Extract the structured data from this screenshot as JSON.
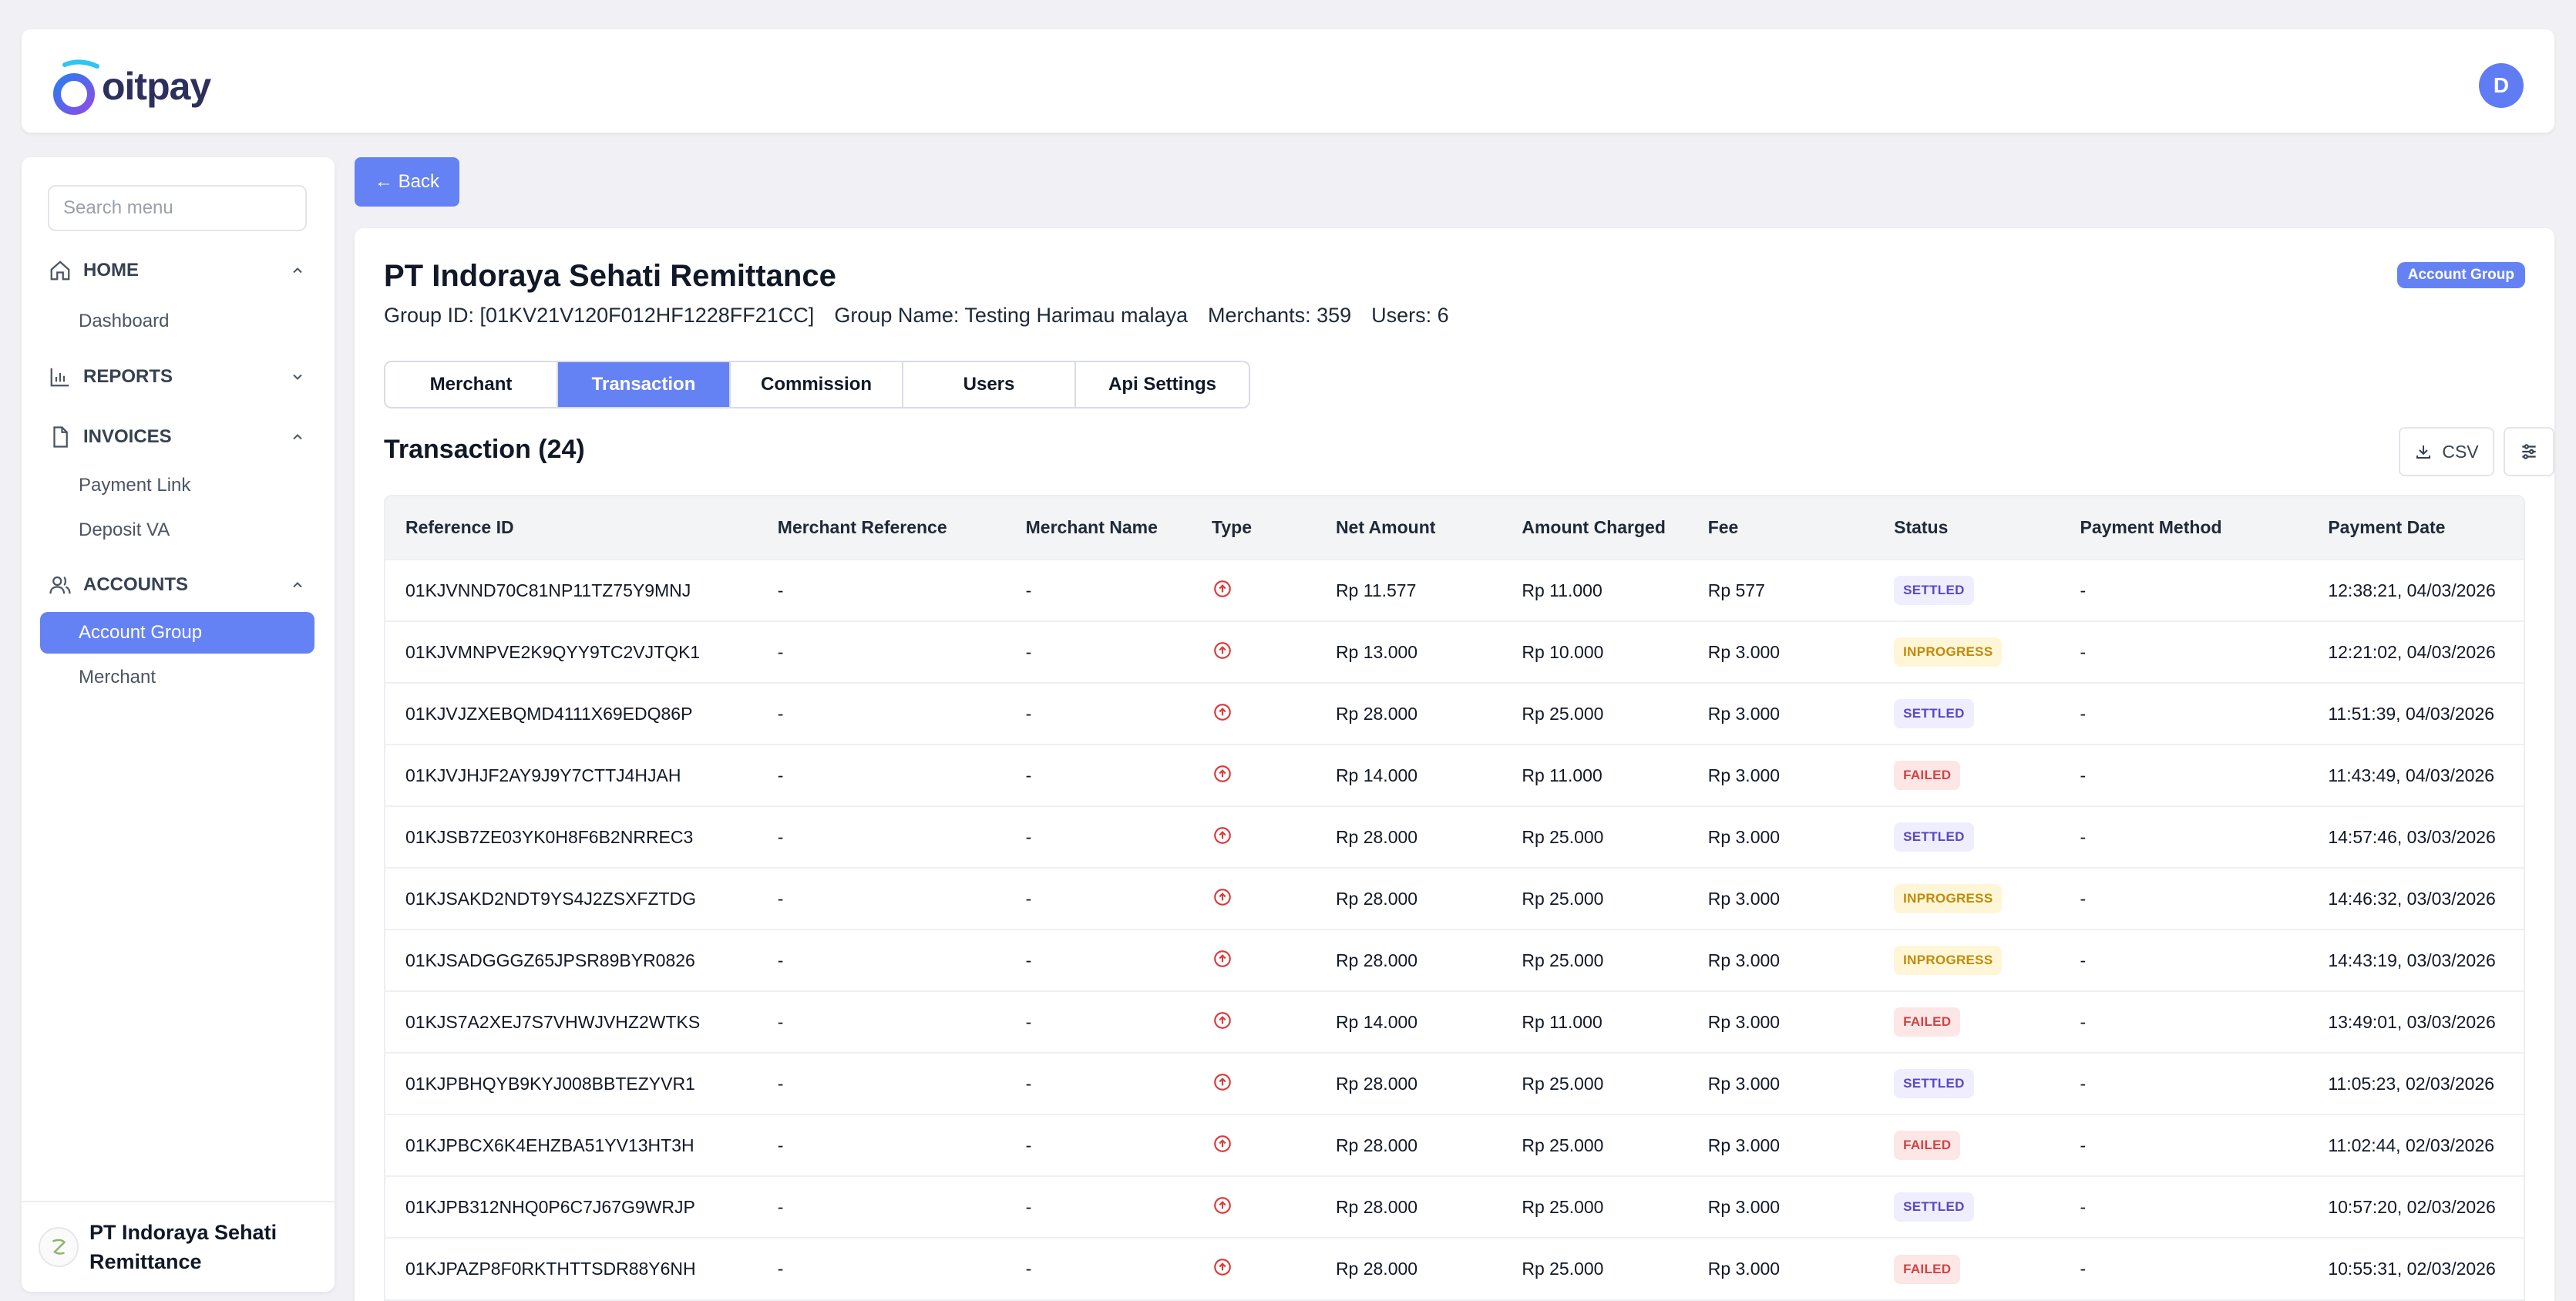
{
  "header": {
    "logo_text": "oitpay",
    "avatar_initial": "D"
  },
  "sidebar": {
    "search_placeholder": "Search menu",
    "sections": [
      {
        "label": "HOME",
        "icon": "home-icon",
        "expanded": true,
        "items": [
          {
            "label": "Dashboard"
          }
        ]
      },
      {
        "label": "REPORTS",
        "icon": "bar-chart-icon",
        "expanded": false,
        "items": []
      },
      {
        "label": "INVOICES",
        "icon": "document-icon",
        "expanded": true,
        "items": [
          {
            "label": "Payment Link"
          },
          {
            "label": "Deposit VA"
          }
        ]
      },
      {
        "label": "ACCOUNTS",
        "icon": "users-icon",
        "expanded": true,
        "items": [
          {
            "label": "Account Group",
            "active": true
          },
          {
            "label": "Merchant"
          }
        ]
      }
    ],
    "footer_org_name": "PT Indoraya Sehati Remittance"
  },
  "back_label": "← Back",
  "page": {
    "title": "PT Indoraya Sehati Remittance",
    "badge": "Account Group",
    "group_id": "Group ID: [01KV21V120F012HF1228FF21CC]",
    "group_name": "Group Name: Testing Harimau malaya",
    "merchants": "Merchants: 359",
    "users": "Users: 6",
    "tabs": [
      {
        "label": "Merchant",
        "active": false
      },
      {
        "label": "Transaction",
        "active": true
      },
      {
        "label": "Commission",
        "active": false
      },
      {
        "label": "Users",
        "active": false
      },
      {
        "label": "Api Settings",
        "active": false
      }
    ],
    "section_title": "Transaction (24)",
    "csv_label": "CSV"
  },
  "table": {
    "columns": [
      "Reference ID",
      "Merchant Reference",
      "Merchant Name",
      "Type",
      "Net Amount",
      "Amount Charged",
      "Fee",
      "Status",
      "Payment Method",
      "Payment Date"
    ],
    "rows": [
      {
        "ref": "01KJVNND70C81NP11TZ75Y9MNJ",
        "mref": "-",
        "mname": "-",
        "net": "Rp 11.577",
        "charged": "Rp 11.000",
        "fee": "Rp 577",
        "status": "SETTLED",
        "method": "-",
        "date": "12:38:21, 04/03/2026"
      },
      {
        "ref": "01KJVMNPVE2K9QYY9TC2VJTQK1",
        "mref": "-",
        "mname": "-",
        "net": "Rp 13.000",
        "charged": "Rp 10.000",
        "fee": "Rp 3.000",
        "status": "INPROGRESS",
        "method": "-",
        "date": "12:21:02, 04/03/2026"
      },
      {
        "ref": "01KJVJZXEBQMD4111X69EDQ86P",
        "mref": "-",
        "mname": "-",
        "net": "Rp 28.000",
        "charged": "Rp 25.000",
        "fee": "Rp 3.000",
        "status": "SETTLED",
        "method": "-",
        "date": "11:51:39, 04/03/2026"
      },
      {
        "ref": "01KJVJHJF2AY9J9Y7CTTJ4HJAH",
        "mref": "-",
        "mname": "-",
        "net": "Rp 14.000",
        "charged": "Rp 11.000",
        "fee": "Rp 3.000",
        "status": "FAILED",
        "method": "-",
        "date": "11:43:49, 04/03/2026"
      },
      {
        "ref": "01KJSB7ZE03YK0H8F6B2NRREC3",
        "mref": "-",
        "mname": "-",
        "net": "Rp 28.000",
        "charged": "Rp 25.000",
        "fee": "Rp 3.000",
        "status": "SETTLED",
        "method": "-",
        "date": "14:57:46, 03/03/2026"
      },
      {
        "ref": "01KJSAKD2NDT9YS4J2ZSXFZTDG",
        "mref": "-",
        "mname": "-",
        "net": "Rp 28.000",
        "charged": "Rp 25.000",
        "fee": "Rp 3.000",
        "status": "INPROGRESS",
        "method": "-",
        "date": "14:46:32, 03/03/2026"
      },
      {
        "ref": "01KJSADGGGZ65JPSR89BYR0826",
        "mref": "-",
        "mname": "-",
        "net": "Rp 28.000",
        "charged": "Rp 25.000",
        "fee": "Rp 3.000",
        "status": "INPROGRESS",
        "method": "-",
        "date": "14:43:19, 03/03/2026"
      },
      {
        "ref": "01KJS7A2XEJ7S7VHWJVHZ2WTKS",
        "mref": "-",
        "mname": "-",
        "net": "Rp 14.000",
        "charged": "Rp 11.000",
        "fee": "Rp 3.000",
        "status": "FAILED",
        "method": "-",
        "date": "13:49:01, 03/03/2026"
      },
      {
        "ref": "01KJPBHQYB9KYJ008BBTEZYVR1",
        "mref": "-",
        "mname": "-",
        "net": "Rp 28.000",
        "charged": "Rp 25.000",
        "fee": "Rp 3.000",
        "status": "SETTLED",
        "method": "-",
        "date": "11:05:23, 02/03/2026"
      },
      {
        "ref": "01KJPBCX6K4EHZBA51YV13HT3H",
        "mref": "-",
        "mname": "-",
        "net": "Rp 28.000",
        "charged": "Rp 25.000",
        "fee": "Rp 3.000",
        "status": "FAILED",
        "method": "-",
        "date": "11:02:44, 02/03/2026"
      },
      {
        "ref": "01KJPB312NHQ0P6C7J67G9WRJP",
        "mref": "-",
        "mname": "-",
        "net": "Rp 28.000",
        "charged": "Rp 25.000",
        "fee": "Rp 3.000",
        "status": "SETTLED",
        "method": "-",
        "date": "10:57:20, 02/03/2026"
      },
      {
        "ref": "01KJPAZP8F0RKTHTTSDR88Y6NH",
        "mref": "-",
        "mname": "-",
        "net": "Rp 28.000",
        "charged": "Rp 25.000",
        "fee": "Rp 3.000",
        "status": "FAILED",
        "method": "-",
        "date": "10:55:31, 02/03/2026"
      }
    ]
  },
  "colors": {
    "accent": "#6582f5",
    "settled": "#5b46c7",
    "inprogress": "#c08a0b",
    "failed": "#d04343"
  }
}
